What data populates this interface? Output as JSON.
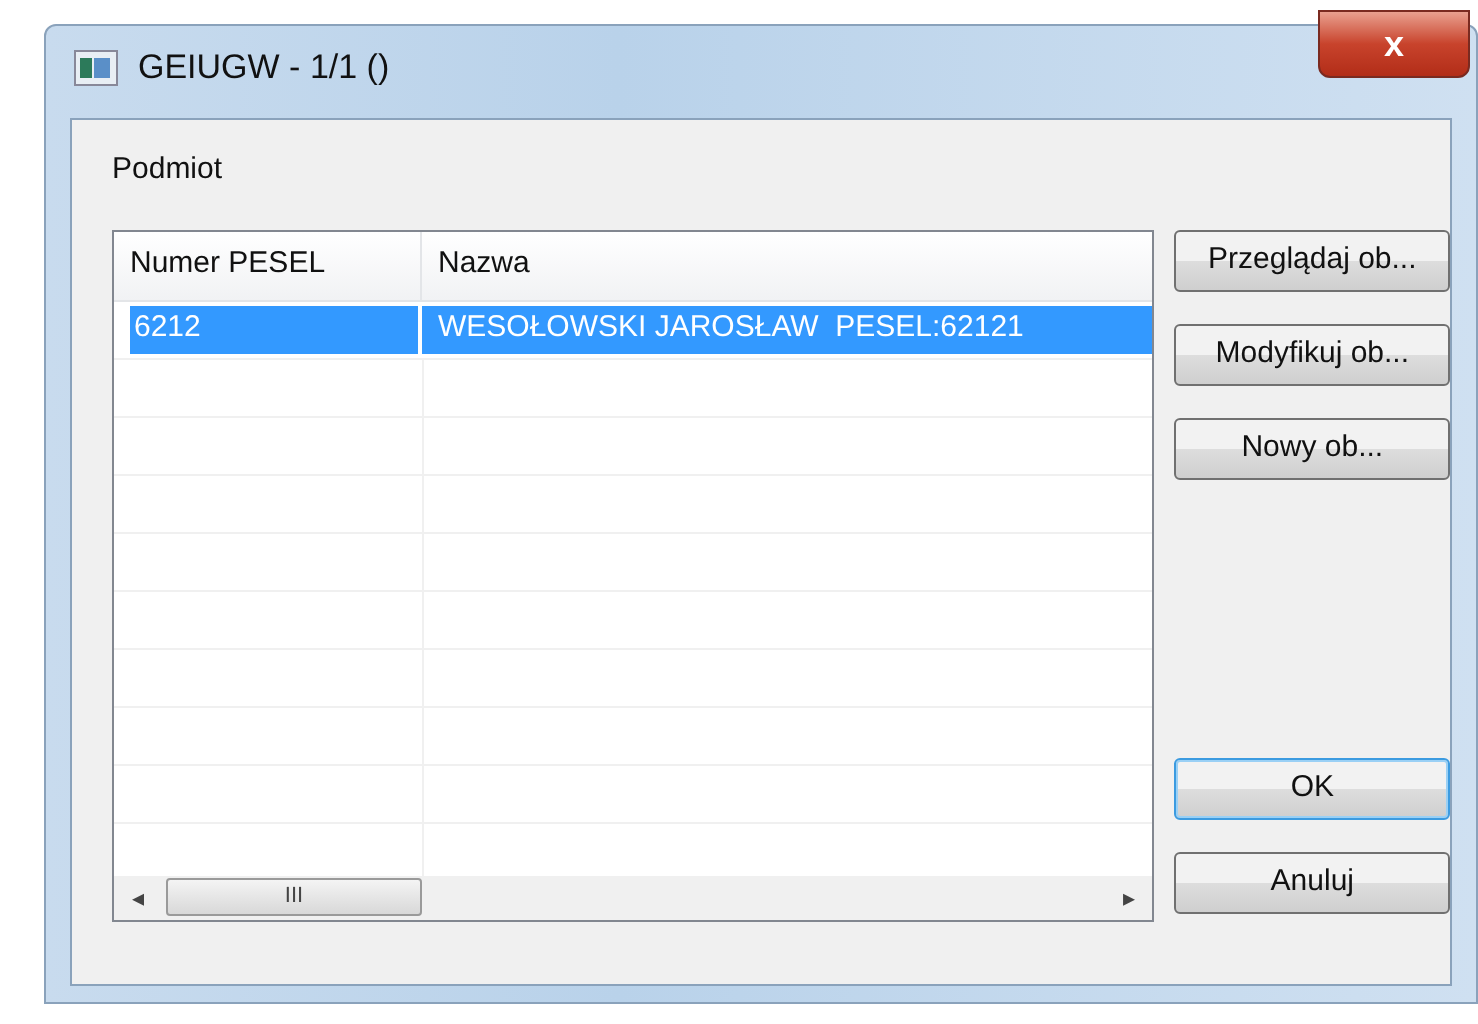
{
  "window": {
    "title": "GEIUGW - 1/1 ()",
    "close_label": "x"
  },
  "group": {
    "label": "Podmiot"
  },
  "table": {
    "columns": [
      "Numer PESEL",
      "Nazwa"
    ],
    "rows": [
      {
        "cells": [
          "6212",
          "WESOŁOWSKI JAROSŁAW  PESEL:62121"
        ],
        "selected": true
      }
    ],
    "scroll_grip": "III",
    "scroll_left": "◂",
    "scroll_right": "▸"
  },
  "side_buttons": [
    "Przeglądaj ob...",
    "Modyfikuj ob...",
    "Nowy ob..."
  ],
  "dialog_buttons": [
    {
      "label": "OK",
      "default": true
    },
    {
      "label": "Anuluj",
      "default": false
    }
  ]
}
